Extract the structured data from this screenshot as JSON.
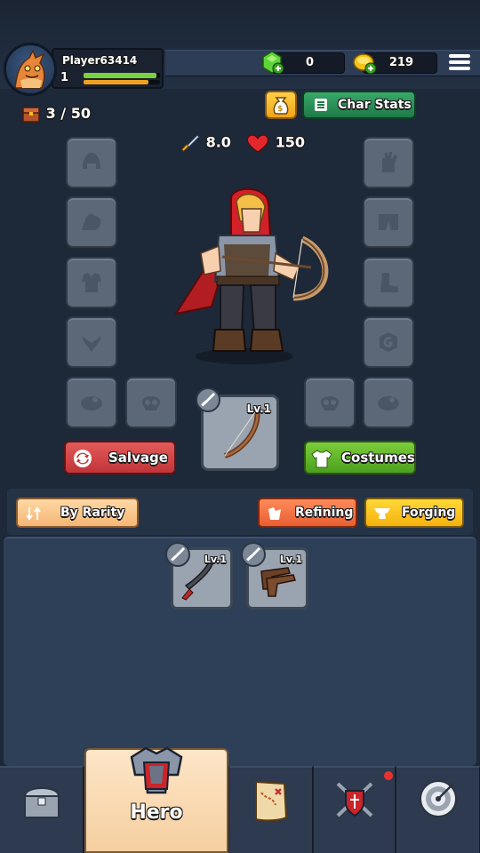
{
  "header": {
    "player_name": "Player63414",
    "player_level": "1",
    "xp_progress": 0.95,
    "energy_progress": 0.85,
    "gems": "0",
    "gold": "219"
  },
  "hero_panel": {
    "chest_count": "3 / 50",
    "char_stats_label": "Char Stats",
    "attack": "8.0",
    "health": "150",
    "equipped_weapon_level": "Lv.1",
    "salvage_label": "Salvage",
    "costumes_label": "Costumes"
  },
  "filters": {
    "rarity_label": "By Rarity",
    "refining_label": "Refining",
    "forging_label": "Forging"
  },
  "inventory": {
    "items": [
      {
        "name": "crooked-blade",
        "level": "Lv.1"
      },
      {
        "name": "pistol-pair",
        "level": "Lv.1"
      }
    ]
  },
  "nav": {
    "tabs": [
      {
        "name": "inventory-chest",
        "label": ""
      },
      {
        "name": "hero",
        "label": "Hero"
      },
      {
        "name": "map",
        "label": ""
      },
      {
        "name": "guild",
        "label": ""
      },
      {
        "name": "target",
        "label": ""
      }
    ]
  },
  "colors": {
    "background": "#1d2838",
    "salvage": "#c03538",
    "costumes": "#4ba01f",
    "charstats": "#1f7a47",
    "active_tab": "#f6cfa0"
  }
}
